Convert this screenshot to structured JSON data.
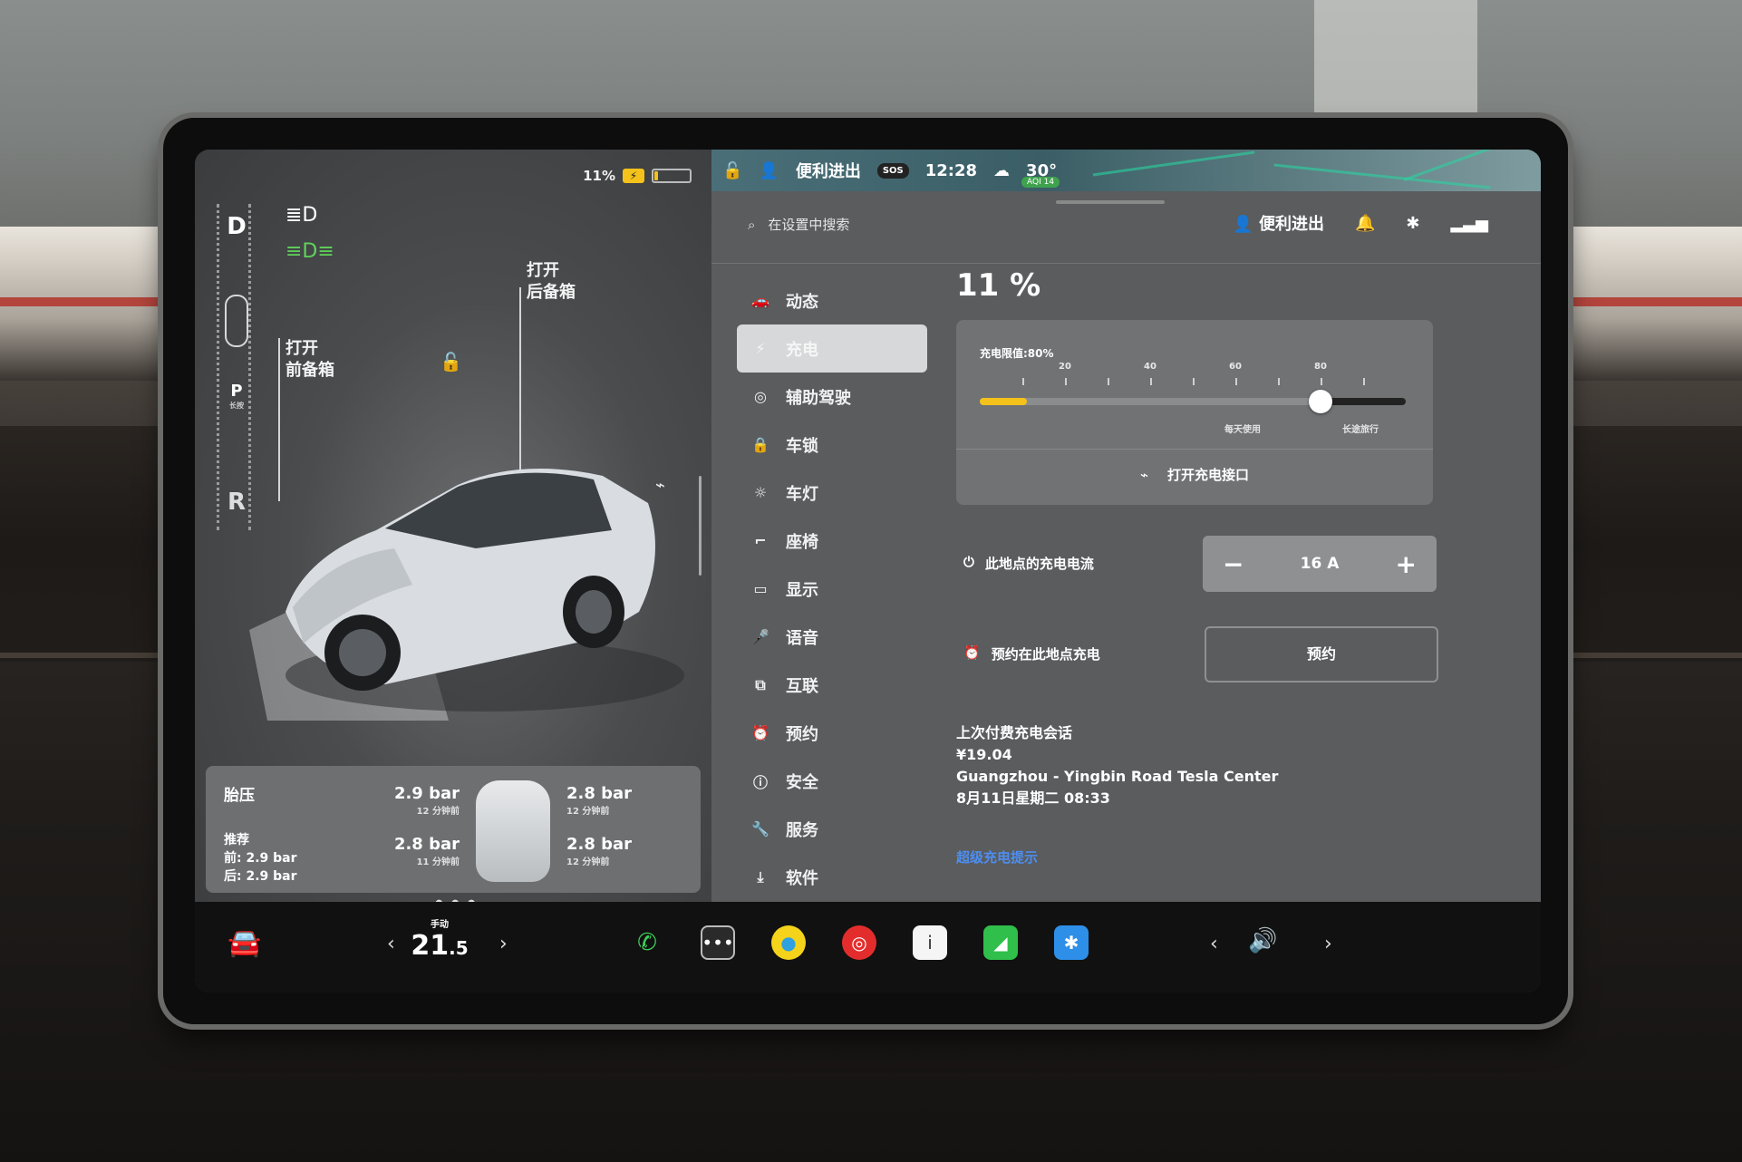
{
  "status": {
    "battery_percent_text": "11%",
    "battery_level": 0.11,
    "profile_name": "便利进出",
    "time": "12:28",
    "temperature": "30°",
    "aqi": "AQI 14",
    "sos": "SOS"
  },
  "car_view": {
    "gear_drive": "D",
    "gear_park": "P",
    "gear_park_sub": "长按",
    "gear_reverse": "R",
    "frunk_label": "打开\n前备箱",
    "trunk_label": "打开\n后备箱"
  },
  "tire": {
    "title": "胎压",
    "std_label": "推荐",
    "std_front": "前: 2.9 bar",
    "std_rear": "后: 2.9 bar",
    "fl": "2.9 bar",
    "fl_time": "12 分钟前",
    "fr": "2.8 bar",
    "fr_time": "12 分钟前",
    "rl": "2.8 bar",
    "rl_time": "11 分钟前",
    "rr": "2.8 bar",
    "rr_time": "12 分钟前"
  },
  "settings": {
    "search_placeholder": "在设置中搜索",
    "profile_label": "便利进出",
    "menu": [
      {
        "label": "动态",
        "icon": "car-icon"
      },
      {
        "label": "充电",
        "icon": "bolt-icon"
      },
      {
        "label": "辅助驾驶",
        "icon": "steering-wheel-icon"
      },
      {
        "label": "车锁",
        "icon": "lock-icon"
      },
      {
        "label": "车灯",
        "icon": "sun-icon"
      },
      {
        "label": "座椅",
        "icon": "seat-icon"
      },
      {
        "label": "显示",
        "icon": "display-icon"
      },
      {
        "label": "语音",
        "icon": "mic-icon"
      },
      {
        "label": "互联",
        "icon": "connect-icon"
      },
      {
        "label": "预约",
        "icon": "alarm-icon"
      },
      {
        "label": "安全",
        "icon": "info-icon"
      },
      {
        "label": "服务",
        "icon": "wrench-icon"
      },
      {
        "label": "软件",
        "icon": "download-icon"
      }
    ]
  },
  "charging": {
    "percent": "11 %",
    "limit_label": "充电限值:80%",
    "limit_value": 80,
    "soc_value": 11,
    "ticks": [
      "20",
      "40",
      "60",
      "80"
    ],
    "range_daily": "每天使用",
    "range_trip": "长途旅行",
    "open_port": "打开充电接口",
    "current_label": "此地点的充电电流",
    "current_value": "16 A",
    "minus": "−",
    "plus": "+",
    "schedule_label": "预约在此地点充电",
    "schedule_button": "预约",
    "last_title": "上次付费充电会话",
    "last_amount": "¥19.04",
    "last_location": "Guangzhou - Yingbin Road Tesla Center",
    "last_date": "8月11日星期二 08:33",
    "tips_link": "超级充电提示"
  },
  "taskbar": {
    "temp_mode": "手动",
    "temp_int": "21",
    "temp_dec": ".5",
    "left_arrow": "‹",
    "right_arrow": "›"
  }
}
